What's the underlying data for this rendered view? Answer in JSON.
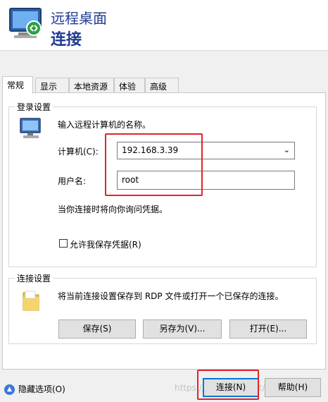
{
  "window": {
    "title": "远程桌面",
    "subtitle": "连接"
  },
  "tabs": [
    {
      "label": "常规"
    },
    {
      "label": "显示"
    },
    {
      "label": "本地资源"
    },
    {
      "label": "体验"
    },
    {
      "label": "高级"
    }
  ],
  "login": {
    "group_label": "登录设置",
    "intro": "输入远程计算机的名称。",
    "computer_label": "计算机(C):",
    "computer_value": "192.168.3.39",
    "username_label": "用户名:",
    "username_value": "root",
    "note": "当你连接时将向你询问凭据。",
    "allow_save_label": "允许我保存凭据(R)"
  },
  "connection": {
    "group_label": "连接设置",
    "desc": "将当前连接设置保存到 RDP 文件或打开一个已保存的连接。",
    "save_label": "保存(S)",
    "save_as_label": "另存为(V)...",
    "open_label": "打开(E)..."
  },
  "footer": {
    "hide_options_label": "隐藏选项(O)",
    "connect_label": "连接(N)",
    "help_label": "帮助(H)",
    "watermark": "https://blog.csdn.net/baidu/tag"
  },
  "colors": {
    "title_blue": "#1f3a93",
    "highlight_red": "#e0242b",
    "focus_blue": "#0078d7"
  },
  "icons": {
    "app": "remote-desktop-icon",
    "computer": "computer-icon",
    "folder": "folder-icon",
    "hide": "chevron-up-icon",
    "dropdown": "chevron-down-icon"
  }
}
